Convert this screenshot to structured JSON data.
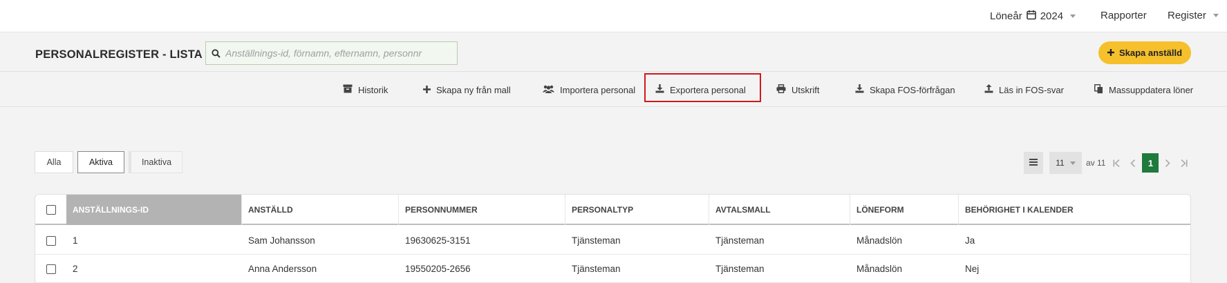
{
  "topnav": {
    "year_label": "Löneår",
    "year_value": "2024",
    "reports": "Rapporter",
    "register": "Register"
  },
  "header": {
    "title": "PERSONALREGISTER - LISTA",
    "search_placeholder": "Anställnings-id, förnamn, efternamn, personnr",
    "create_button": "Skapa anställd"
  },
  "toolbar": {
    "history": "Historik",
    "create_from_template": "Skapa ny från mall",
    "import": "Importera personal",
    "export": "Exportera personal",
    "print": "Utskrift",
    "fos_request": "Skapa FOS-förfrågan",
    "fos_read": "Läs in FOS-svar",
    "mass_update": "Massuppdatera löner"
  },
  "filters": {
    "all": "Alla",
    "active": "Aktiva",
    "inactive": "Inaktiva"
  },
  "pager": {
    "page_size": "11",
    "of_label": "av 11",
    "current_page": "1"
  },
  "table": {
    "columns": [
      "ANSTÄLLNINGS-ID",
      "ANSTÄLLD",
      "PERSONNUMMER",
      "PERSONALTYP",
      "AVTALSMALL",
      "LÖNEFORM",
      "BEHÖRIGHET I KALENDER"
    ],
    "rows": [
      [
        "1",
        "Sam Johansson",
        "19630625-3151",
        "Tjänsteman",
        "Tjänsteman",
        "Månadslön",
        "Ja"
      ],
      [
        "2",
        "Anna Andersson",
        "19550205-2656",
        "Tjänsteman",
        "Tjänsteman",
        "Månadslön",
        "Nej"
      ]
    ]
  },
  "colors": {
    "accent_yellow": "#f5c02c",
    "pager_green": "#1f7a3d",
    "highlight_red": "#d2161b",
    "sorted_header": "#b3b3b3"
  }
}
